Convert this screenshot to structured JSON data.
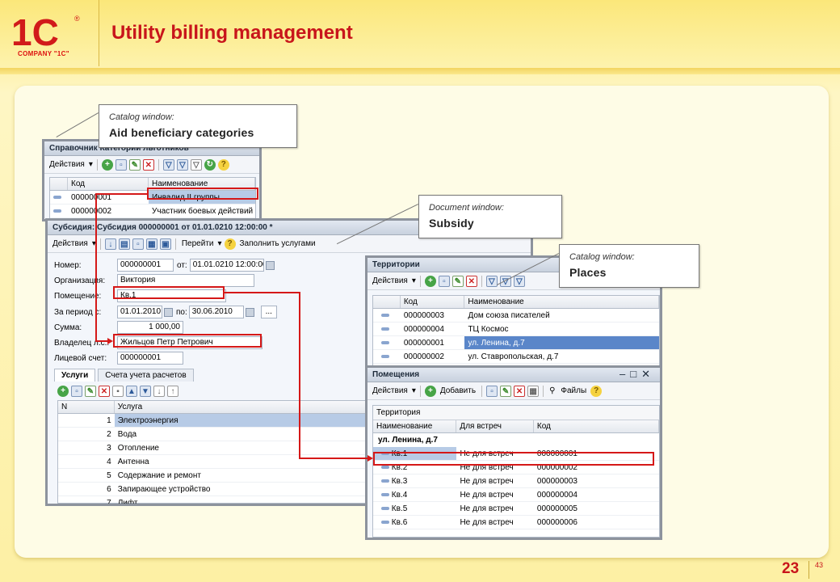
{
  "brand": {
    "logo_mark": "1C",
    "logo_caption": "COMPANY \"1C\"",
    "accent": "#c8151b"
  },
  "slide": {
    "title": "Utility billing management",
    "page": "23",
    "total": "43"
  },
  "callouts": [
    {
      "line1": "Catalog window:",
      "line2": "Aid beneficiary categories"
    },
    {
      "line1": "Document window:",
      "line2": "Subsidy"
    },
    {
      "line1": "Catalog window:",
      "line2": "Places"
    }
  ],
  "win_benef": {
    "title": "Справочник Категории льготников",
    "actions": "Действия",
    "cols": [
      "Код",
      "Наименование"
    ],
    "rows": [
      {
        "code": "000000001",
        "name": "Инвалид II группы"
      },
      {
        "code": "000000002",
        "name": "Участник боевых действий"
      }
    ]
  },
  "win_subsidy": {
    "title": "Субсидия: Субсидия 000000001 от 01.01.0210 12:00:00 *",
    "actions": "Действия",
    "goto": "Перейти",
    "fill": "Заполнить услугами",
    "fields": {
      "number_label": "Номер:",
      "number": "000000001",
      "date_label": "от:",
      "date": "01.01.0210 12:00:00",
      "org_label": "Организация:",
      "org": "Виктория",
      "room_label": "Помещение:",
      "room": "Кв.1",
      "period_label": "За период с:",
      "period_from": "01.01.2010",
      "period_to_label": "по:",
      "period_to": "30.06.2010",
      "sum_label": "Сумма:",
      "sum": "1 000,00",
      "owner_label": "Владелец л.с.:",
      "owner": "Жильцов Петр Петрович",
      "account_label": "Лицевой счет:",
      "account": "000000001"
    },
    "tabs": [
      "Услуги",
      "Счета учета расчетов"
    ],
    "svc_cols": [
      "N",
      "Услуга"
    ],
    "services": [
      {
        "n": "1",
        "name": "Электроэнергия"
      },
      {
        "n": "2",
        "name": "Вода"
      },
      {
        "n": "3",
        "name": "Отопление"
      },
      {
        "n": "4",
        "name": "Антенна"
      },
      {
        "n": "5",
        "name": "Содержание и ремонт"
      },
      {
        "n": "6",
        "name": "Запирающее устройство"
      },
      {
        "n": "7",
        "name": "Лифт"
      }
    ]
  },
  "win_terr": {
    "title": "Территории",
    "actions": "Действия",
    "cols": [
      "Код",
      "Наименование"
    ],
    "rows": [
      {
        "code": "000000003",
        "name": "Дом союза писателей"
      },
      {
        "code": "000000004",
        "name": "ТЦ Космос"
      },
      {
        "code": "000000001",
        "name": "ул. Ленина, д.7"
      },
      {
        "code": "000000002",
        "name": "ул. Ставропольская, д.7"
      }
    ]
  },
  "win_rooms": {
    "title": "Помещения",
    "actions": "Действия",
    "add": "Добавить",
    "files": "Файлы",
    "group_label": "Территория",
    "cols": [
      "Наименование",
      "Для встреч",
      "Код"
    ],
    "group": "ул. Ленина, д.7",
    "rows": [
      {
        "name": "Кв.1",
        "meet": "Не для встреч",
        "code": "000000001"
      },
      {
        "name": "Кв.2",
        "meet": "Не для встреч",
        "code": "000000002"
      },
      {
        "name": "Кв.3",
        "meet": "Не для встреч",
        "code": "000000003"
      },
      {
        "name": "Кв.4",
        "meet": "Не для встреч",
        "code": "000000004"
      },
      {
        "name": "Кв.5",
        "meet": "Не для встреч",
        "code": "000000005"
      },
      {
        "name": "Кв.6",
        "meet": "Не для встреч",
        "code": "000000006"
      }
    ]
  }
}
